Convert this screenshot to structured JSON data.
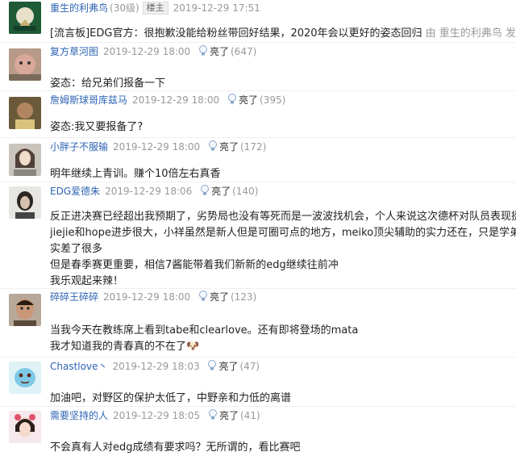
{
  "top": {
    "user": "重生的利弗鸟",
    "level": "(30级)",
    "badge": "楼主",
    "time": "2019-12-29 17:51",
    "content_main": "[流言板]EDG官方：很抱歉没能给粉丝带回好结果，2020年会以更好的姿态回归",
    "content_tail": " 由  重生的利弗鸟 发表在"
  },
  "replies": [
    {
      "user": "复方草河图",
      "time": "2019-12-29 18:00",
      "like_label": "亮了",
      "like_count": "(647)",
      "lines": [
        "姿态：给兄弟们报备一下"
      ]
    },
    {
      "user": "詹姆斯球哥库兹马",
      "time": "2019-12-29 18:00",
      "like_label": "亮了",
      "like_count": "(395)",
      "lines": [
        "姿态:我又要报备了?"
      ]
    },
    {
      "user": "小胖子不服输",
      "time": "2019-12-29 18:00",
      "like_label": "亮了",
      "like_count": "(172)",
      "lines": [
        "明年继续上青训。赚个10倍左右真香"
      ]
    },
    {
      "user": "EDG爱德朱",
      "time": "2019-12-29 18:06",
      "like_label": "亮了",
      "like_count": "(140)",
      "lines": [
        "反正进决赛已经超出我预期了，劣势局也没有等死而是一波波找机会，个人来说这次德杯对队员表现挺满",
        "jiejie和hope进步很大，小祥虽然是新人但是可圈可点的地方，meiko顶尖辅助的实力还在，只是学弟今天",
        "实差了很多",
        "但是春季赛更重要，相信7酱能带着我们新新的edg继续往前冲",
        "我乐观起来辣！"
      ]
    },
    {
      "user": "碎碎王碎碎",
      "time": "2019-12-29 18:00",
      "like_label": "亮了",
      "like_count": "(123)",
      "lines": [
        "当我今天在教练席上看到tabe和clearlove。还有即将登场的mata",
        "我才知道我的青春真的不在了🐶"
      ]
    },
    {
      "user": "Chastlove丶",
      "time": "2019-12-29 18:03",
      "like_label": "亮了",
      "like_count": "(47)",
      "lines": [
        "加油吧，对野区的保护太低了，中野亲和力低的离谱"
      ]
    },
    {
      "user": "需要坚持的人",
      "time": "2019-12-29 18:05",
      "like_label": "亮了",
      "like_count": "(41)",
      "lines": [
        "不会真有人对edg成绩有要求吗？无所谓的，看比赛吧"
      ]
    }
  ],
  "colors": {
    "username": "#2d64b3",
    "meta": "#999999",
    "text": "#222222"
  },
  "icons": {
    "like": "lightbulb-icon"
  }
}
